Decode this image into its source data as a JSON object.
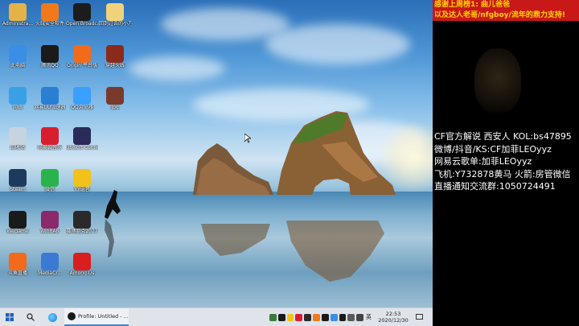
{
  "desktop_icons": [
    {
      "label": "Administra...",
      "color": "#e3b24a"
    },
    {
      "label": "火绒安全软件",
      "color": "#f07a1a"
    },
    {
      "label": "Open Broadcast...",
      "color": "#1c1c1c"
    },
    {
      "label": "回到过去的小方法 12.21",
      "color": "#f0d27a"
    },
    {
      "label": "此电脑",
      "color": "#3a8ee6"
    },
    {
      "label": "腾讯QQ",
      "color": "#1a1a1a"
    },
    {
      "label": "Origin 平台版",
      "color": "#f26a1b"
    },
    {
      "label": "穿越火线",
      "color": "#8a2a1a"
    },
    {
      "label": "网络",
      "color": "#3aa0e6"
    },
    {
      "label": "网易UU加速器",
      "color": "#2a7fd4"
    },
    {
      "label": "QQ浏览器",
      "color": "#3aa0ff"
    },
    {
      "label": "jpg",
      "color": "#7a3a2a"
    },
    {
      "label": "回收站",
      "color": "#c7d3df"
    },
    {
      "label": "网易云音乐",
      "color": "#d81e2e"
    },
    {
      "label": "Ubisoft Connect",
      "color": "#2b2b5a"
    },
    {
      "label": "Steam",
      "color": "#1b3a5c"
    },
    {
      "label": "微信",
      "color": "#2ab34a"
    },
    {
      "label": "YY语音",
      "color": "#f2c21a"
    },
    {
      "label": "WeGame",
      "color": "#1a1a1a"
    },
    {
      "label": "WinRAR",
      "color": "#8a2a6a"
    },
    {
      "label": "赛博朋克2077",
      "color": "#2a2a2a"
    },
    {
      "label": "斗鱼直播",
      "color": "#f26a1b"
    },
    {
      "label": "MediaCr...",
      "color": "#3a7ad4"
    },
    {
      "label": "Among Us",
      "color": "#d81e1e"
    }
  ],
  "taskbar": {
    "start_icon": "windows-logo",
    "search_icon": "search",
    "active_app_label": "Profile: Untitled - ...",
    "time": "22:53",
    "date": "2020/12/30",
    "ime": "英"
  },
  "stream_panel": {
    "banner_line1": "感谢上周榜1: 曲儿爸爸",
    "banner_line2": "以及达人老哥/nfgboy/流年的鼎力支持!",
    "info_lines": [
      "CF官方解说 西安人 KOL:bs47895",
      "微博/抖音/KS:CF加菲LEOyyz",
      "网易云歌单:加菲LEOyyz",
      "飞机:Y732878黄马 火箭:房管微信",
      "直播通知交流群:1050724491"
    ]
  }
}
